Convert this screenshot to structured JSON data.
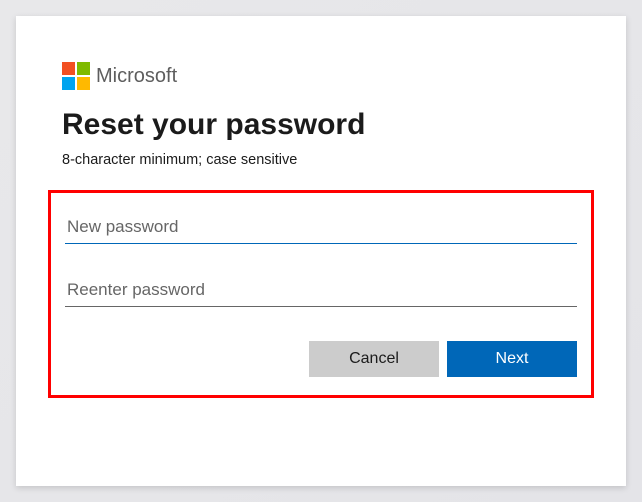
{
  "brand": {
    "name": "Microsoft",
    "logo_colors": {
      "tl": "#f25022",
      "tr": "#7fba00",
      "bl": "#00a4ef",
      "br": "#ffb900"
    }
  },
  "title": "Reset your password",
  "subtitle": "8-character minimum; case sensitive",
  "fields": {
    "new_password": {
      "placeholder": "New password",
      "value": ""
    },
    "reenter_password": {
      "placeholder": "Reenter password",
      "value": ""
    }
  },
  "buttons": {
    "cancel": "Cancel",
    "next": "Next"
  },
  "colors": {
    "primary": "#0067b8",
    "secondary": "#cccccc",
    "highlight_border": "#ff0000"
  }
}
